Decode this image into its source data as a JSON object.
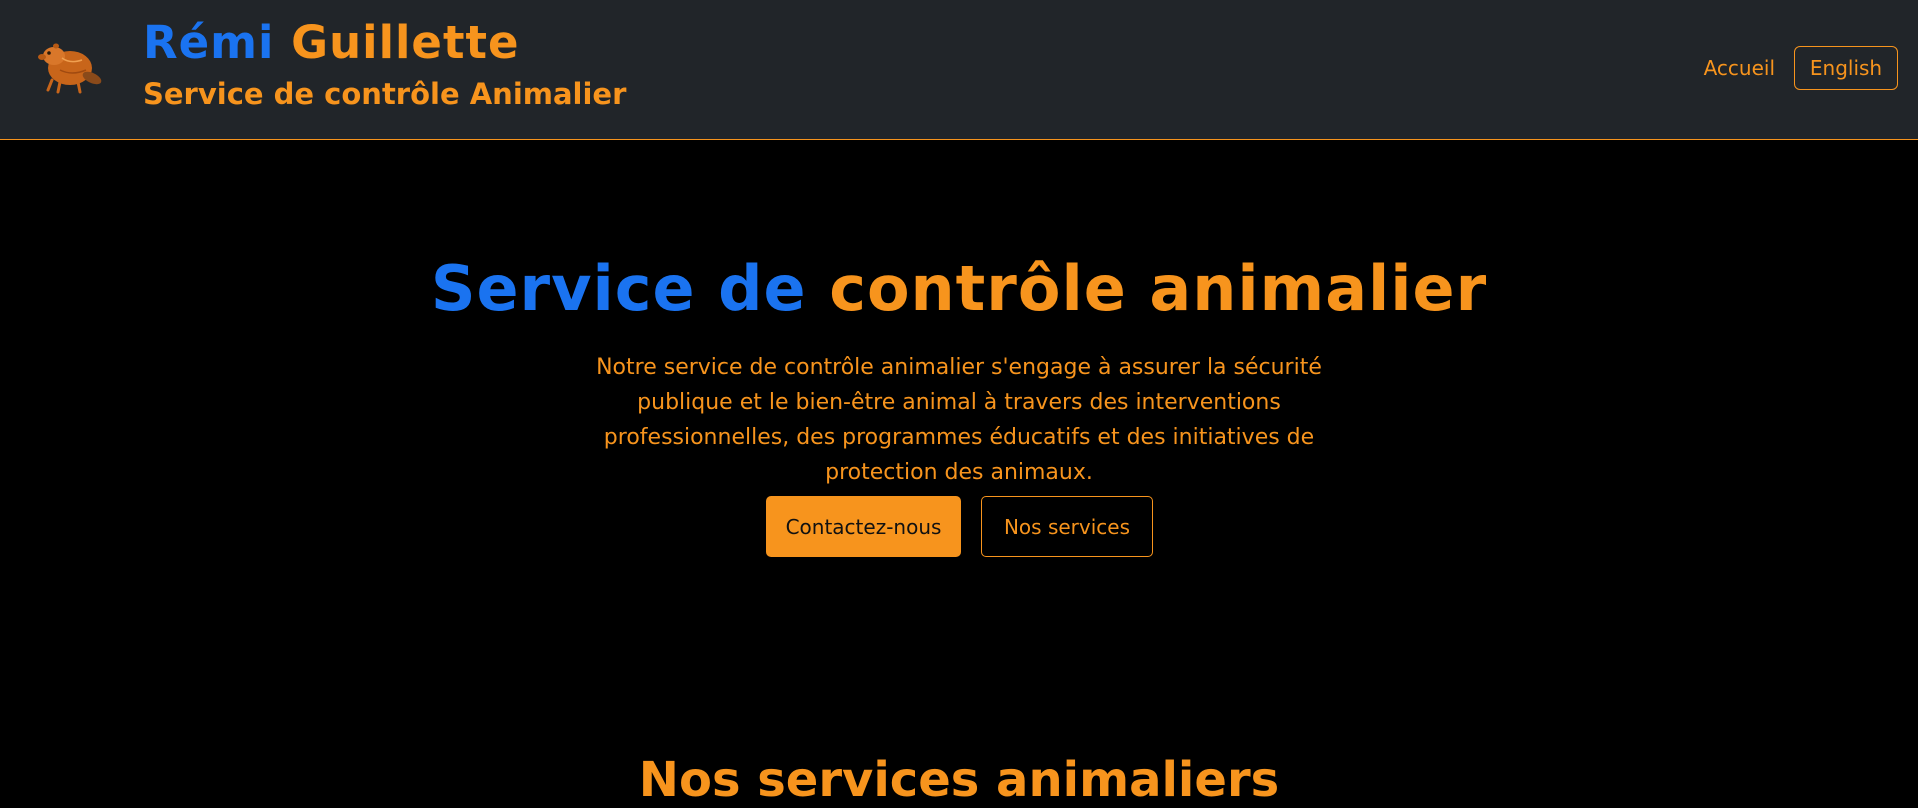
{
  "header": {
    "logo_icon": "beaver-logo-icon",
    "brand_first": "Rémi",
    "brand_last": "Guillette",
    "subtitle": "Service de contrôle Animalier",
    "nav": {
      "home_label": "Accueil",
      "language_label": "English"
    }
  },
  "hero": {
    "title_part1": "Service de",
    "title_part2": "contrôle animalier",
    "description": "Notre service de contrôle animalier s'engage à assurer la sécurité publique et le bien-être animal à travers des interventions professionnelles, des programmes éducatifs et des initiatives de protection des animaux.",
    "contact_button": "Contactez-nous",
    "services_button": "Nos services"
  },
  "services_section": {
    "title": "Nos services animaliers"
  },
  "colors": {
    "accent_orange": "#f7941d",
    "accent_blue": "#1a73f0",
    "header_bg": "#212529",
    "page_bg": "#000000"
  }
}
